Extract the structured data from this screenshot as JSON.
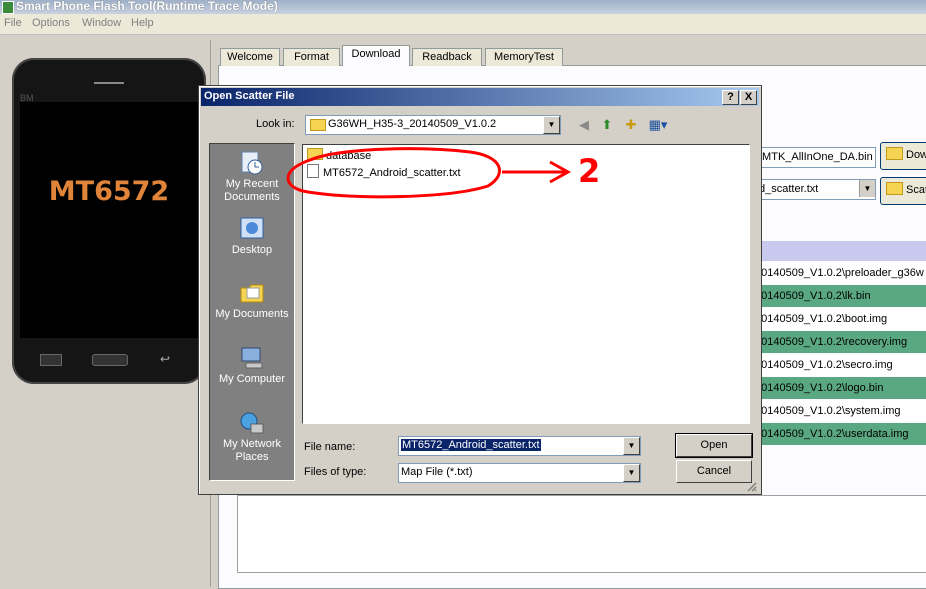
{
  "app": {
    "title": "Smart Phone Flash Tool(Runtime Trace Mode)",
    "menu": [
      "File",
      "Options",
      "Window",
      "Help"
    ]
  },
  "phone": {
    "brand": "BM",
    "model": "MT6572"
  },
  "tabs": [
    "Welcome",
    "Format",
    "Download",
    "Readback",
    "MemoryTest"
  ],
  "active_tab": "Download",
  "download": {
    "da_path": "\\MTK_AllInOne_DA.bin",
    "da_button": "Dow",
    "scatter_path": "d_scatter.txt",
    "scatter_button": "Scat",
    "rows": [
      "20140509_V1.0.2\\preloader_g36w",
      "20140509_V1.0.2\\lk.bin",
      "20140509_V1.0.2\\boot.img",
      "20140509_V1.0.2\\recovery.img",
      "20140509_V1.0.2\\secro.img",
      "20140509_V1.0.2\\logo.bin",
      "20140509_V1.0.2\\system.img",
      "20140509_V1.0.2\\userdata.img"
    ]
  },
  "dialog": {
    "title": "Open Scatter File",
    "help_btn": "?",
    "close_btn": "X",
    "look_in_label": "Look in:",
    "look_in_value": "G36WH_H35-3_20140509_V1.0.2",
    "places": [
      "My Recent Documents",
      "Desktop",
      "My Documents",
      "My Computer",
      "My Network Places"
    ],
    "files": [
      {
        "name": "database",
        "type": "folder"
      },
      {
        "name": "MT6572_Android_scatter.txt",
        "type": "file"
      }
    ],
    "file_name_label": "File name:",
    "file_name_value": "MT6572_Android_scatter.txt",
    "file_type_label": "Files of type:",
    "file_type_value": "Map File (*.txt)",
    "open_btn": "Open",
    "cancel_btn": "Cancel"
  },
  "annotation": {
    "number": "2",
    "color": "#ff0000"
  }
}
